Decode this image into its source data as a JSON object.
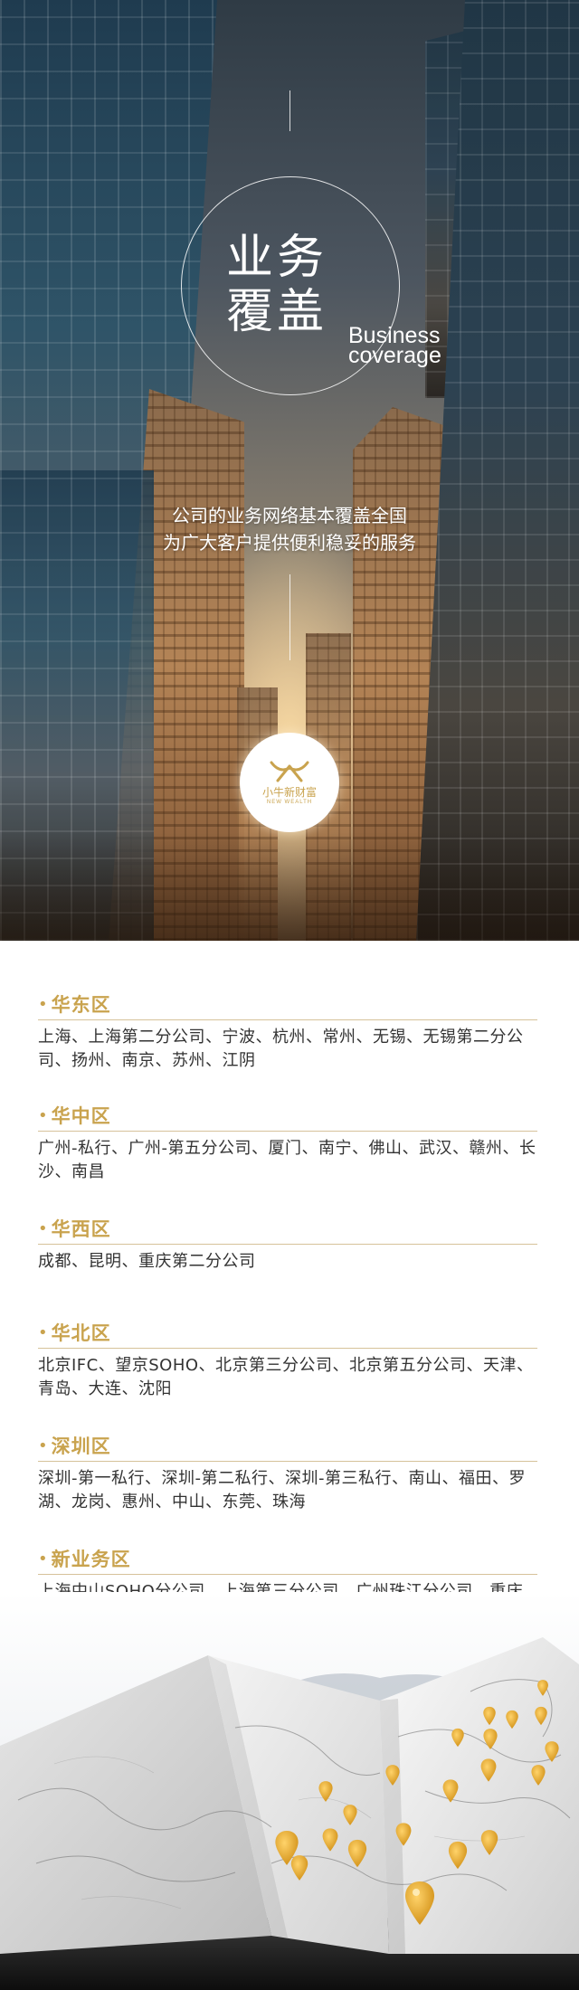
{
  "hero": {
    "title_cn_line1": "业务",
    "title_cn_line2": "覆盖",
    "title_en_line1": "Business",
    "title_en_line2": "coverage",
    "subtitle_line1": "公司的业务网络基本覆盖全国",
    "subtitle_line2": "为广大客户提供便利稳妥的服务"
  },
  "logo": {
    "name": "小牛新财富",
    "en": "NEW WEALTH",
    "color": "#c9a34e"
  },
  "regions": [
    {
      "name": "华东区",
      "text": "上海、上海第二分公司、宁波、杭州、常州、无锡、无锡第二分公司、扬州、南京、苏州、江阴"
    },
    {
      "name": "华中区",
      "text": "广州-私行、广州-第五分公司、厦门、南宁、佛山、武汉、赣州、长沙、南昌"
    },
    {
      "name": "华西区",
      "text": "成都、昆明、重庆第二分公司"
    },
    {
      "name": "华北区",
      "text": "北京IFC、望京SOHO、北京第三分公司、北京第五分公司、天津、青岛、大连、沈阳"
    },
    {
      "name": "深圳区",
      "text": "深圳-第一私行、深圳-第二私行、深圳-第三私行、南山、福田、罗湖、龙岗、惠州、中山、东莞、珠海"
    },
    {
      "name": "新业务区",
      "text": "上海中山SOHO分公司、上海第三分公司、广州珠江分公司、重庆分公司"
    }
  ],
  "colors": {
    "accent_gold": "#c9a34e",
    "rule": "#d6c29a",
    "body_text": "#333333"
  }
}
